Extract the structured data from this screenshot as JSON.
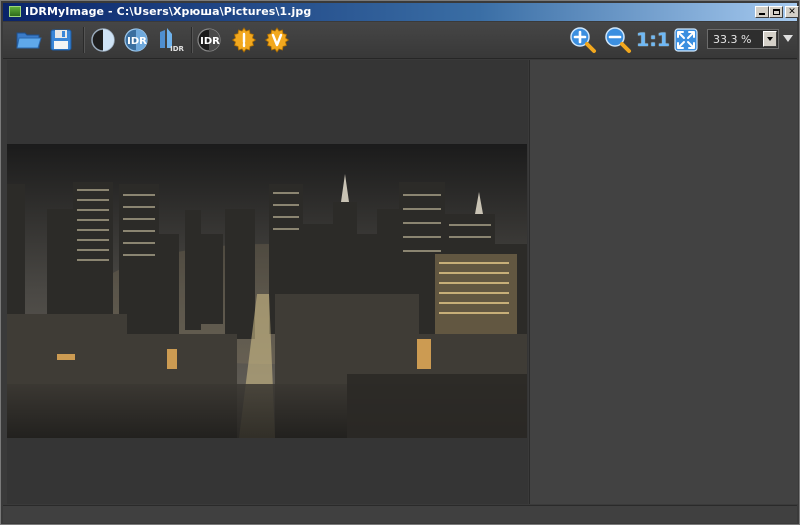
{
  "window": {
    "title": "IDRMyImage - C:\\Users\\Хрюша\\Pictures\\1.jpg",
    "controls": {
      "close": "✕"
    }
  },
  "toolbar": {
    "zoom": {
      "value": "33.3 %"
    },
    "actual_size_label": "1:1",
    "idr_label_1": "IDR",
    "idr_label_2": "IDR",
    "idr_label_3": "IDR",
    "icons": [
      "open-folder-icon",
      "save-floppy-icon",
      "contrast-icon",
      "idr-icon",
      "split-idr-icon",
      "idr-dark-icon",
      "settings-gear-icon",
      "info-gear-icon",
      "zoom-in-icon",
      "zoom-out-icon",
      "actual-size-icon",
      "fit-screen-icon"
    ]
  },
  "image": {
    "subject": "night-city-hdr-photo"
  },
  "colors": {
    "titlebar_start": "#0a246a",
    "titlebar_end": "#a6caf0",
    "accent_orange": "#f2a81e",
    "accent_blue": "#3b8fe0"
  }
}
